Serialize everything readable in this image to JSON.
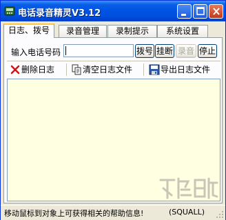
{
  "window": {
    "title": "电话录音精灵V3.12"
  },
  "title_buttons": {
    "minimize_icon": "minimize-icon",
    "maximize_icon": "maximize-icon",
    "close_icon": "close-icon"
  },
  "tabs": [
    {
      "label": "日志、拨号",
      "active": true
    },
    {
      "label": "录音管理",
      "active": false
    },
    {
      "label": "录制提示",
      "active": false
    },
    {
      "label": "系统设置",
      "active": false
    }
  ],
  "dial": {
    "label": "输入电话号码",
    "input_value": "",
    "dial_button": "拨号",
    "hangup_button": "挂断",
    "record_button": "录音",
    "stop_button": "停止"
  },
  "toolbar": {
    "delete_log": "删除日志",
    "clear_log_file": "清空日志文件",
    "export_log_file": "导出日志文件"
  },
  "status": {
    "hint": "移动鼠标到对象上可获得相关的帮助信息!",
    "author": "(SQUALL)"
  },
  "colors": {
    "titlebar": "#0054e3",
    "log_background": "#ffffe1",
    "active_tab_highlight": "#ffc83c"
  }
}
